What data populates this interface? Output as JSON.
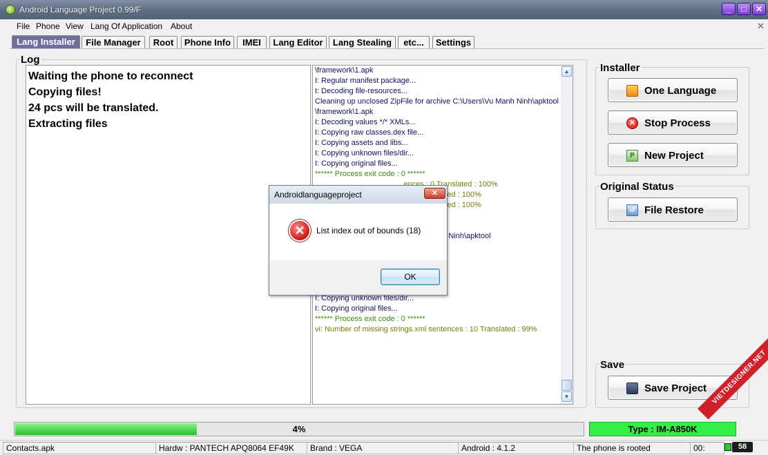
{
  "window": {
    "title": "Android Language Project 0.99/F"
  },
  "menu": [
    "File",
    "Phone",
    "View",
    "Lang Of Application",
    "About"
  ],
  "tabs": [
    "Lang Installer",
    "File Manager",
    "Root",
    "Phone Info",
    "IMEI",
    "Lang Editor",
    "Lang Stealing",
    "etc...",
    "Settings"
  ],
  "log": {
    "label": "Log",
    "left_lines": [
      "Waiting the phone to reconnect",
      "Copying files!",
      "24 pcs will be translated.",
      "Extracting files"
    ],
    "right_lines": [
      {
        "text": "\\framework\\1.apk",
        "tone": "blue"
      },
      {
        "text": "I: Regular manifest package...",
        "tone": "blue"
      },
      {
        "text": "I: Decoding file-resources...",
        "tone": "blue"
      },
      {
        "text": "Cleaning up unclosed ZipFile for archive C:\\Users\\Vu Manh Ninh\\apktool",
        "tone": "blue"
      },
      {
        "text": "\\framework\\1.apk",
        "tone": "blue"
      },
      {
        "text": "I: Decoding values */* XMLs...",
        "tone": "blue"
      },
      {
        "text": "I: Copying raw classes.dex file...",
        "tone": "blue"
      },
      {
        "text": "I: Copying assets and libs...",
        "tone": "blue"
      },
      {
        "text": "I: Copying unknown files/dir...",
        "tone": "blue"
      },
      {
        "text": "I: Copying original files...",
        "tone": "blue"
      },
      {
        "text": "****** Process exit code : 0 ******",
        "tone": "green"
      },
      {
        "text": "                                          ences : 0 Translated : 100%",
        "tone": "olive"
      },
      {
        "text": "                                          s : 0 Translated : 100%",
        "tone": "olive"
      },
      {
        "text": "                                          s : 0 Translated : 100%",
        "tone": "olive"
      },
      {
        "text": "",
        "tone": "blue"
      },
      {
        "text": "",
        "tone": "blue"
      },
      {
        "text": "",
        "tone": "blue"
      },
      {
        "text": "                                          s.apk",
        "tone": "blue"
      },
      {
        "text": "",
        "tone": "blue"
      },
      {
        "text": "",
        "tone": "blue"
      },
      {
        "text": "                                          sources...",
        "tone": "blue"
      },
      {
        "text": "                                          ers\\Vu Manh Ninh\\apktool",
        "tone": "blue"
      },
      {
        "text": "\\framework\\1.apk",
        "tone": "blue"
      },
      {
        "text": "I: Regular manifest package...",
        "tone": "blue"
      },
      {
        "text": "I: Decoding file-resources...",
        "tone": "blue"
      },
      {
        "text": "I: Decoding values */* XMLs...",
        "tone": "blue"
      },
      {
        "text": "I: Copying assets and libs...",
        "tone": "blue"
      },
      {
        "text": "I: Copying unknown files/dir...",
        "tone": "blue"
      },
      {
        "text": "I: Copying original files...",
        "tone": "blue"
      },
      {
        "text": "****** Process exit code : 0 ******",
        "tone": "green"
      },
      {
        "text": "vi: Number of missing strings.xml sentences : 10 Translated : 99%",
        "tone": "olive"
      }
    ]
  },
  "installer": {
    "label": "Installer",
    "one_language": "One Language",
    "stop_process": "Stop Process",
    "new_project": "New Project"
  },
  "original_status": {
    "label": "Original Status",
    "file_restore": "File Restore"
  },
  "save": {
    "label": "Save",
    "save_project": "Save Project"
  },
  "progress": {
    "value": 0.04,
    "text": "4%"
  },
  "type_box": "Type : IM-A850K",
  "status": {
    "file": "Contacts.apk",
    "hardware": "Hardw : PANTECH APQ8064 EF49K",
    "brand": "Brand : VEGA",
    "android": "Android : 4.1.2",
    "rooted": "The phone is rooted",
    "time": "00:",
    "battery": "58"
  },
  "dialog": {
    "title": "Androidlanguageproject",
    "message": "List index out of bounds (18)",
    "ok": "OK"
  },
  "watermark": "VIETDESIGNER.NET",
  "colors": {
    "tab_active": "#6f6f9f",
    "progress": "#22c022",
    "type_box": "#33ee44",
    "error": "#cc1818"
  }
}
